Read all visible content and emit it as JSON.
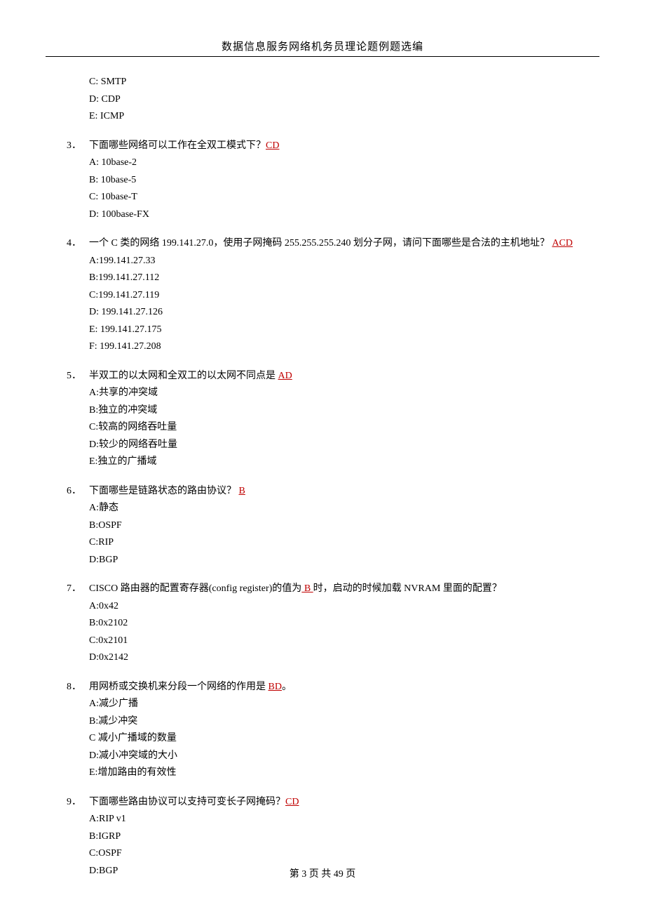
{
  "header": {
    "title": "数据信息服务网络机务员理论题例题选编"
  },
  "prevOptions": [
    "C: SMTP",
    "D: CDP",
    "E: ICMP"
  ],
  "questions": [
    {
      "num": "3．",
      "text_pre": "下面哪些网络可以工作在全双工模式下？",
      "answer": "CD",
      "text_post": "",
      "options": [
        "A: 10base-2",
        "B: 10base-5",
        "C: 10base-T",
        "D: 100base-FX"
      ]
    },
    {
      "num": "4．",
      "text_pre": "一个 C 类的网络 199.141.27.0，使用子网掩码 255.255.255.240 划分子网，请问下面哪些是合法的主机地址？ ",
      "answer": " ACD",
      "text_post": "",
      "options": [
        "A:199.141.27.33",
        "B:199.141.27.112",
        "C:199.141.27.119",
        "D: 199.141.27.126",
        "E: 199.141.27.175",
        "F: 199.141.27.208"
      ]
    },
    {
      "num": "5．",
      "text_pre": "半双工的以太网和全双工的以太网不同点是 ",
      "answer": "AD",
      "text_post": "",
      "options": [
        "A:共享的冲突域",
        "B:独立的冲突域",
        "C:较高的网络吞吐量",
        "D:较少的网络吞吐量",
        "E:独立的广播域"
      ]
    },
    {
      "num": "6．",
      "text_pre": "下面哪些是链路状态的路由协议？ ",
      "answer": " B ",
      "text_post": "",
      "options": [
        "A:静态",
        "B:OSPF",
        "C:RIP",
        "D:BGP"
      ]
    },
    {
      "num": "7．",
      "text_pre": "CISCO 路由器的配置寄存器(config register)的值为",
      "answer": "  B  ",
      "text_post": "时，启动的时候加载 NVRAM 里面的配置？",
      "options": [
        "A:0x42",
        "B:0x2102",
        "C:0x2101",
        "D:0x2142"
      ]
    },
    {
      "num": "8．",
      "text_pre": "用网桥或交换机来分段一个网络的作用是 ",
      "answer": "BD",
      "text_post": "。",
      "options": [
        "A:减少广播",
        "B:减少冲突",
        "C 减小广播域的数量",
        "D:减小冲突域的大小",
        "E:增加路由的有效性"
      ]
    },
    {
      "num": "9．",
      "text_pre": "下面哪些路由协议可以支持可变长子网掩码？",
      "answer": "CD",
      "text_post": "",
      "options": [
        "A:RIP v1",
        "B:IGRP",
        "C:OSPF",
        "D:BGP"
      ]
    }
  ],
  "footer": {
    "text": "第 3 页 共 49 页"
  }
}
